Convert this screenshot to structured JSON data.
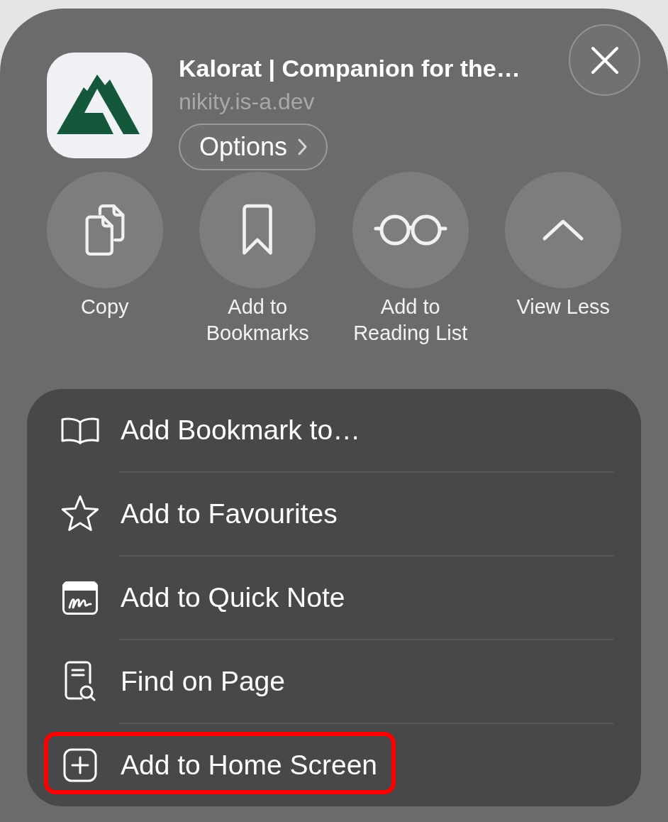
{
  "header": {
    "title": "Kalorat | Companion for the…",
    "url": "nikity.is-a.dev",
    "options": "Options"
  },
  "actions": [
    {
      "kind": "copy",
      "label": "Copy"
    },
    {
      "kind": "bookmark",
      "label": "Add to Bookmarks"
    },
    {
      "kind": "glasses",
      "label": "Add to Reading List"
    },
    {
      "kind": "chevron",
      "label": "View Less"
    }
  ],
  "menu": [
    {
      "kind": "book",
      "label": "Add Bookmark to…",
      "highlighted": false
    },
    {
      "kind": "star",
      "label": "Add to Favourites",
      "highlighted": false
    },
    {
      "kind": "note",
      "label": "Add to Quick Note",
      "highlighted": false
    },
    {
      "kind": "find",
      "label": "Find on Page",
      "highlighted": false
    },
    {
      "kind": "add",
      "label": "Add to Home Screen",
      "highlighted": true
    }
  ]
}
